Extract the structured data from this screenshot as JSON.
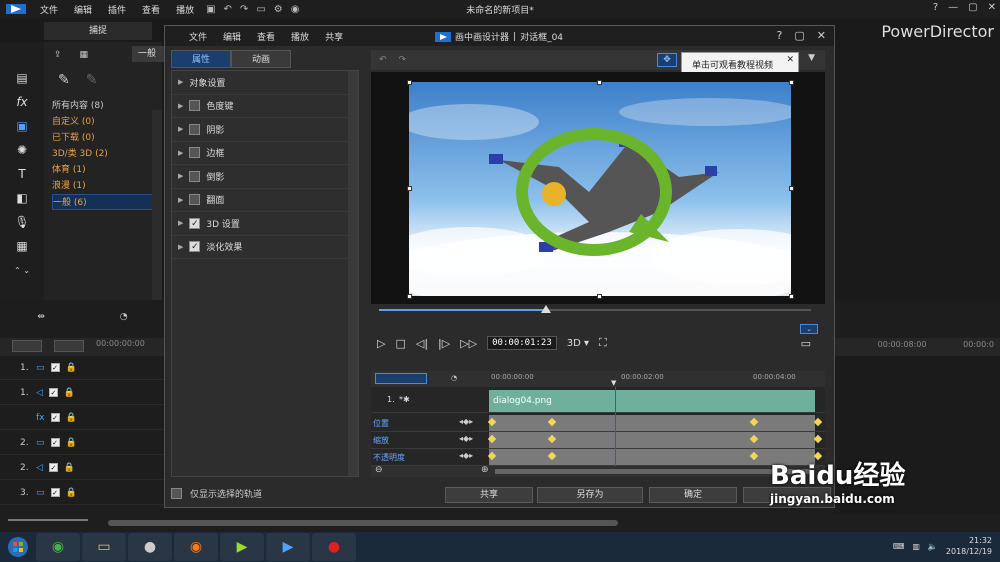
{
  "menubar": {
    "items": [
      "文件",
      "编辑",
      "插件",
      "查看",
      "播放"
    ],
    "title": "未命名的新项目*",
    "help": "?",
    "brand": "PowerDirector"
  },
  "capture_tab": "捕捉",
  "left_panel": {
    "select": "一般",
    "items": [
      {
        "label": "所有内容 (8)",
        "orange": false
      },
      {
        "label": "自定义 (0)",
        "orange": true
      },
      {
        "label": "已下载 (0)",
        "orange": true
      },
      {
        "label": "3D/类 3D (2)",
        "orange": true
      },
      {
        "label": "体育 (1)",
        "orange": true
      },
      {
        "label": "浪漫 (1)",
        "orange": true
      },
      {
        "label": "一般 (6)",
        "orange": true,
        "selected": true
      }
    ]
  },
  "timeline": {
    "ruler_start": "00:00:00:00",
    "ruler_right1": "00:00:08:00",
    "ruler_right2": "00:00:0",
    "tracks": [
      "1.",
      "1.",
      "",
      "2.",
      "2.",
      "3."
    ]
  },
  "dialog": {
    "menu": [
      "文件",
      "编辑",
      "查看",
      "播放",
      "共享"
    ],
    "title_app": "画中画设计器",
    "title_sep": "|",
    "title_name": "对话框_04",
    "tabs": [
      "属性",
      "动画"
    ],
    "props": [
      {
        "label": "对象设置",
        "cb": null
      },
      {
        "label": "色度键",
        "cb": false
      },
      {
        "label": "阴影",
        "cb": false
      },
      {
        "label": "边框",
        "cb": false
      },
      {
        "label": "倒影",
        "cb": false
      },
      {
        "label": "翻面",
        "cb": false
      },
      {
        "label": "3D 设置",
        "cb": true
      },
      {
        "label": "淡化效果",
        "cb": true
      }
    ],
    "only_selected": "仅显示选择的轨道",
    "tooltip": "单击可观看教程视频",
    "timecode": "00:00:01:23",
    "mode3d": "3D",
    "kf_ruler": [
      "00:00:00:00",
      "00:00:02:00",
      "00:00:04:00"
    ],
    "track_label": "1.",
    "clip": "dialog04.png",
    "kf_rows": [
      "位置",
      "缩放",
      "不透明度"
    ],
    "buttons": {
      "share": "共享",
      "saveas": "另存为",
      "ok": "确定"
    }
  },
  "taskbar": {
    "time": "21:32",
    "date": "2018/12/19"
  },
  "watermark": {
    "main": "Baidu经验",
    "url": "jingyan.baidu.com"
  }
}
